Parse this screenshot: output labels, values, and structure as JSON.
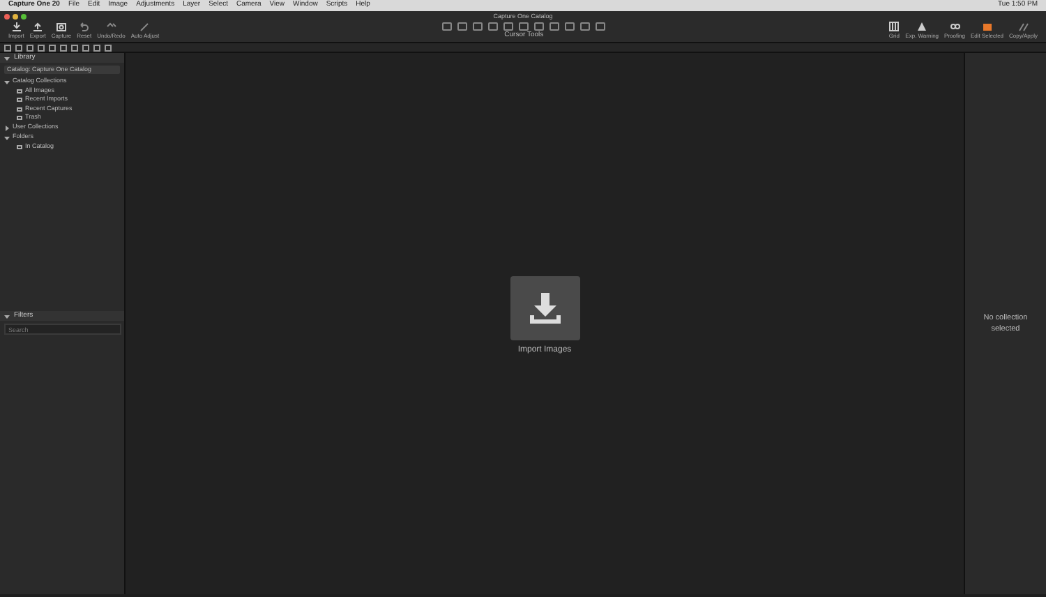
{
  "menu_bar": {
    "app": "Capture One 20",
    "items": [
      "File",
      "Edit",
      "Image",
      "Adjustments",
      "Layer",
      "Select",
      "Camera",
      "View",
      "Window",
      "Scripts",
      "Help"
    ],
    "clock": "Tue 1:50 PM"
  },
  "window": {
    "title": "Capture One Catalog"
  },
  "toolbar_left": [
    {
      "label": "Import",
      "kind": "import"
    },
    {
      "label": "Export",
      "kind": "export"
    },
    {
      "label": "Capture",
      "kind": "camera"
    },
    {
      "label": "Reset",
      "kind": "undo"
    },
    {
      "label": "Undo/Redo",
      "kind": "undoredo"
    },
    {
      "label": "Auto Adjust",
      "kind": "wand"
    }
  ],
  "cursor_tools": {
    "label": "Cursor Tools"
  },
  "toolbar_right": [
    {
      "label": "Grid",
      "kind": "grid"
    },
    {
      "label": "Exp. Warning",
      "kind": "warning"
    },
    {
      "label": "Proofing",
      "kind": "glasses"
    },
    {
      "label": "Edit Selected",
      "kind": "edit"
    },
    {
      "label": "Copy/Apply",
      "kind": "copy"
    }
  ],
  "library": {
    "title": "Library",
    "catalog": "Catalog: Capture One Catalog",
    "sections": [
      {
        "label": "Catalog Collections",
        "expanded": true,
        "children": [
          {
            "label": "All Images"
          },
          {
            "label": "Recent Imports"
          },
          {
            "label": "Recent Captures"
          },
          {
            "label": "Trash"
          }
        ]
      },
      {
        "label": "User Collections",
        "expanded": false
      },
      {
        "label": "Folders",
        "expanded": true,
        "children": [
          {
            "label": "In Catalog"
          }
        ]
      }
    ]
  },
  "filters": {
    "title": "Filters",
    "placeholder": "Search"
  },
  "viewer": {
    "import_label": "Import Images"
  },
  "right_panel": {
    "message": "No collection selected"
  }
}
